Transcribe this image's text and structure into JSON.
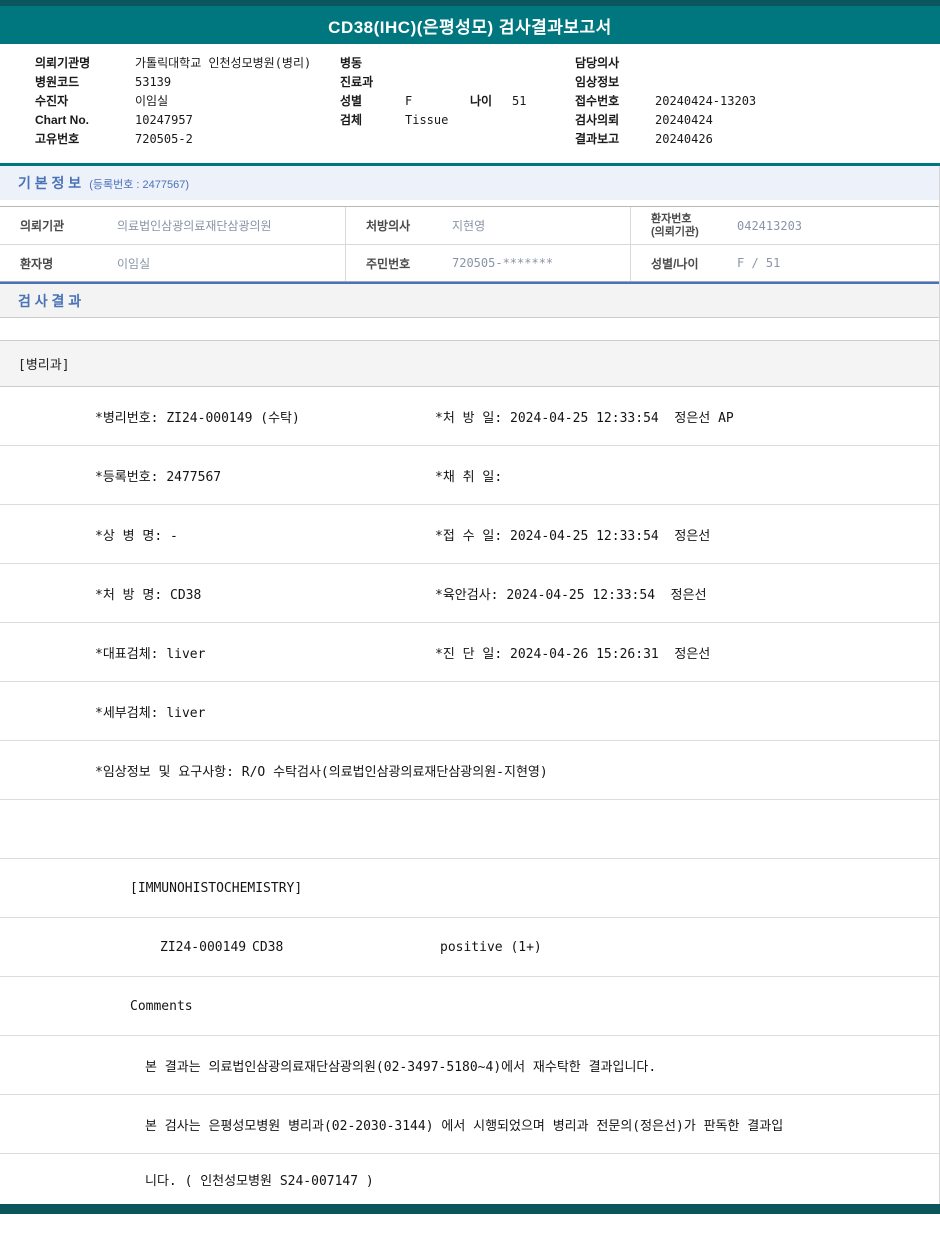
{
  "title_bar": {
    "title": "CD38(IHC)(은평성모) 검사결과보고서"
  },
  "patient_header": {
    "left": [
      {
        "label": "의뢰기관명",
        "value": "가톨릭대학교 인천성모병원(병리)"
      },
      {
        "label": "병원코드",
        "value": "53139"
      },
      {
        "label": "수진자",
        "value": "이임실"
      },
      {
        "label": "Chart No.",
        "value": "10247957"
      },
      {
        "label": "고유번호",
        "value": "720505-2"
      }
    ],
    "middle": [
      {
        "label": "병동",
        "value": ""
      },
      {
        "label": "진료과",
        "value": ""
      },
      {
        "label": "성별",
        "value": "F",
        "label2": "나이",
        "value2": "51"
      },
      {
        "label": "검체",
        "value": "Tissue"
      }
    ],
    "right": [
      {
        "label": "담당의사",
        "value": ""
      },
      {
        "label": "임상정보",
        "value": ""
      },
      {
        "label": "접수번호",
        "value": "20240424-13203"
      },
      {
        "label": "검사의뢰",
        "value": "20240424"
      },
      {
        "label": "결과보고",
        "value": "20240426"
      }
    ]
  },
  "basic_info": {
    "title": "기 본 정 보",
    "subtitle": "(등록번호 : 2477567)",
    "row1": {
      "c1_label": "의뢰기관",
      "c1_value": "의료법인삼광의료재단삼광의원",
      "c2_label": "처방의사",
      "c2_value": "지현영",
      "c3_label_line1": "환자번호",
      "c3_label_line2": "(의뢰기관)",
      "c3_value": "042413203"
    },
    "row2": {
      "c1_label": "환자명",
      "c1_value": "이임실",
      "c2_label": "주민번호",
      "c2_value": "720505-*******",
      "c3_label": "성별/나이",
      "c3_value": "F / 51"
    }
  },
  "results": {
    "title": "검 사 결 과",
    "department": "[병리과]",
    "rows": [
      {
        "left": "*병리번호: ZI24-000149 (수탁)",
        "right": "*처 방 일: 2024-04-25 12:33:54  정은선 AP"
      },
      {
        "left": "*등록번호: 2477567",
        "right": "*채 취 일:"
      },
      {
        "left": "*상 병 명: -",
        "right": "*접 수 일: 2024-04-25 12:33:54  정은선"
      },
      {
        "left": "*처 방 명: CD38",
        "right": "*육안검사: 2024-04-25 12:33:54  정은선"
      },
      {
        "left": "*대표검체: liver",
        "right": "*진 단 일: 2024-04-26 15:26:31  정은선"
      },
      {
        "left": "*세부검체: liver",
        "right": ""
      },
      {
        "left": "*임상정보 및 요구사항: R/O 수탁검사(의료법인삼광의료재단삼광의원-지현영)",
        "right": ""
      }
    ],
    "ihc": {
      "header": "[IMMUNOHISTOCHEMISTRY]",
      "specimen_no": "ZI24-000149",
      "test_name": "CD38",
      "result": "positive (1+)",
      "comments_label": "Comments",
      "comment_lines": [
        "본 결과는 의료법인삼광의료재단삼광의원(02-3497-5180~4)에서 재수탁한 결과입니다.",
        "본 검사는 은평성모병원 병리과(02-2030-3144) 에서 시행되었으며 병리과 전문의(정은선)가 판독한 결과입",
        "니다. ( 인천성모병원 S24-007147 )"
      ]
    }
  }
}
